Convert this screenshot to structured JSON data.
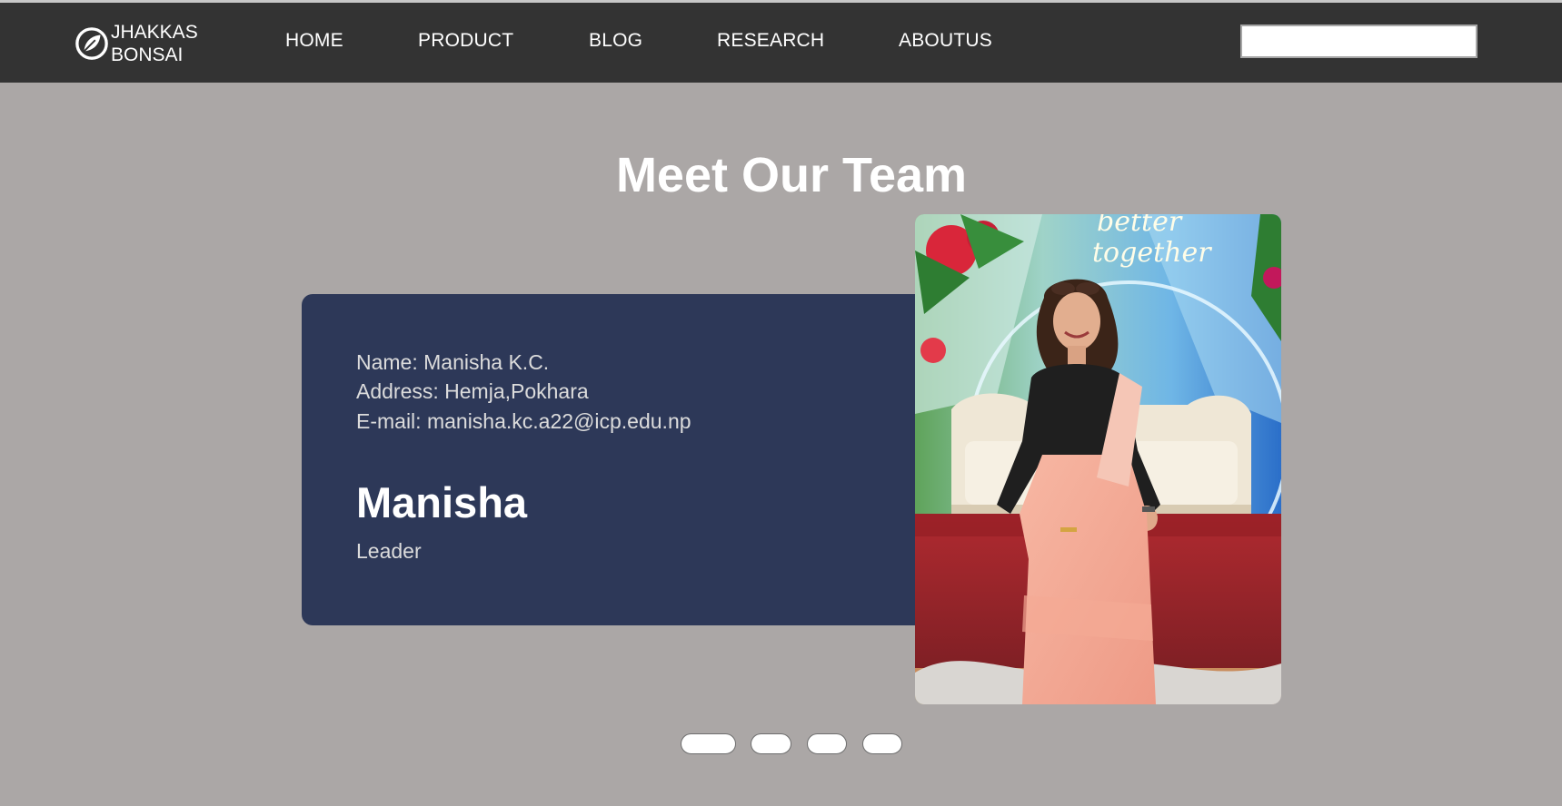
{
  "nav": {
    "brand_line1": "JHAKKAS",
    "brand_line2": "BONSAI",
    "brand_icon": "leaf-icon",
    "links": [
      "HOME",
      "PRODUCT",
      "BLOG",
      "RESEARCH",
      "ABOUTUS"
    ],
    "search_value": ""
  },
  "main": {
    "title": "Meet Our Team"
  },
  "member": {
    "name_line": "Name: Manisha K.C.",
    "address_line": "Address: Hemja,Pokhara",
    "email_line": "E-mail: manisha.kc.a22@icp.edu.np",
    "display_name": "Manisha",
    "role": "Leader",
    "photo_sign_text": "better together"
  },
  "slider": {
    "total_slides": 4,
    "active_slide": 1
  },
  "colors": {
    "page_background": "#aba7a6",
    "navbar": "#333333",
    "card": "#2d3858",
    "text_light": "#dcdcdc",
    "white": "#ffffff"
  }
}
